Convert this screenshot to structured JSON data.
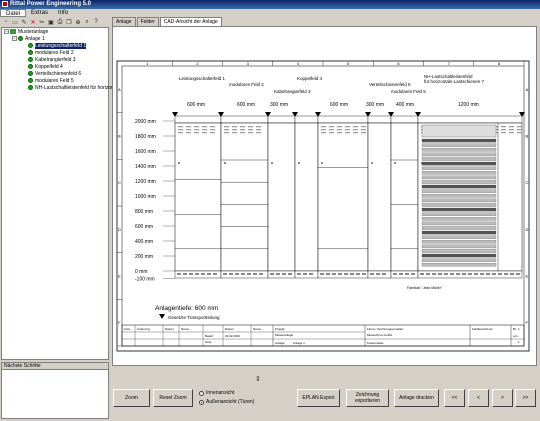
{
  "window": {
    "title": "Rittal Power Engineering 5.0"
  },
  "menu": [
    "Datei",
    "Extras",
    "Info"
  ],
  "toolbar_icons": [
    "new-icon",
    "open-icon",
    "wrench-icon",
    "delete-icon",
    "cut-icon",
    "save-icon",
    "print-icon",
    "copy-icon",
    "zoom-icon",
    "search-icon",
    "help-icon"
  ],
  "tree": {
    "root": "Musteranlage",
    "anlage": "Anlage 1",
    "items": [
      "Leistungsschalterfeld 1",
      "modulares Feld 2",
      "Kabelrangierfeld 3",
      "Koppelfeld 4",
      "Verteilschienenfeld 6",
      "modulares Feld 5",
      "NH-Lastschaltleistenfeld für horizont"
    ]
  },
  "bottom_panel": {
    "title": "Nächste Schritte"
  },
  "tabs": [
    "Anlage",
    "Felder",
    "CAD-Ansicht der Anlage"
  ],
  "drawing": {
    "col_numbers": [
      "1",
      "2",
      "3",
      "4",
      "5",
      "6",
      "7",
      "8"
    ],
    "row_letters": [
      "A",
      "B",
      "C",
      "D",
      "E",
      "F"
    ],
    "field_labels": {
      "f1": "Leistungsschalterfeld 1",
      "f2": "modulares Feld 2",
      "f3": "Kabelrangierfeld 3",
      "f4": "Koppelfeld 4",
      "f5": "modulares Feld 5",
      "f6": "Verteilschienenfeld 6",
      "f7a": "NH-Lastschaltleistenfeld",
      "f7b": "für horizontale Lastschienen 7"
    },
    "widths": [
      "600 mm",
      "600 mm",
      "300 mm",
      "600 mm",
      "300 mm",
      "400 mm",
      "1200 mm"
    ],
    "heights": [
      "2000 mm",
      "1800 mm",
      "1600 mm",
      "1400 mm",
      "1200 mm",
      "1000 mm",
      "800 mm",
      "600 mm",
      "400 mm",
      "200 mm",
      "0 mm",
      "-100 mm"
    ],
    "depth_label": "Anlagentiefe: 600 mm",
    "transport_label": "Gesetzte Transportteilung",
    "fabrikat": "Fabrikat: \"Jean Müller\"",
    "titleblock": {
      "h": [
        "Zust.",
        "Änderung",
        "Datum",
        "Name",
        "Datum",
        "Name"
      ],
      "datum_val": "02.02.2010",
      "bearb": "Bearb",
      "gepr": "Gepr",
      "projekt": "Projekt:",
      "projekt_name": "Musteranlage",
      "firma": "Firma / Zeichnungsersteller:",
      "firma_name": "Musterfirma GmbH",
      "kostenstelle": "Kostenstelle:",
      "anlage_label": "Anlage:",
      "anlage_val": "Anlage 1",
      "feldbez": "Feldbezeichner:",
      "bl": "Bl.",
      "bl_val": "1",
      "von": "von",
      "von_val": "1"
    }
  },
  "buttons": {
    "zoom": "Zoom",
    "reset_zoom": "Reset Zoom",
    "eplan": "EPLAN Export",
    "zeichnung_1": "Zeichnung",
    "zeichnung_2": "exportieren",
    "drucken": "Anlage drucken",
    "first": "<<",
    "prev": "<",
    "next": ">",
    "last": ">>"
  },
  "radios": {
    "inner": "Innenansicht",
    "outer": "Außenansicht (Türen)",
    "selected": "outer"
  },
  "colors": {
    "title_bar": "#0a246a",
    "tree_selection": "#0a246a",
    "field_green": "#1aa31a",
    "window_bg": "#d4d0c8"
  }
}
